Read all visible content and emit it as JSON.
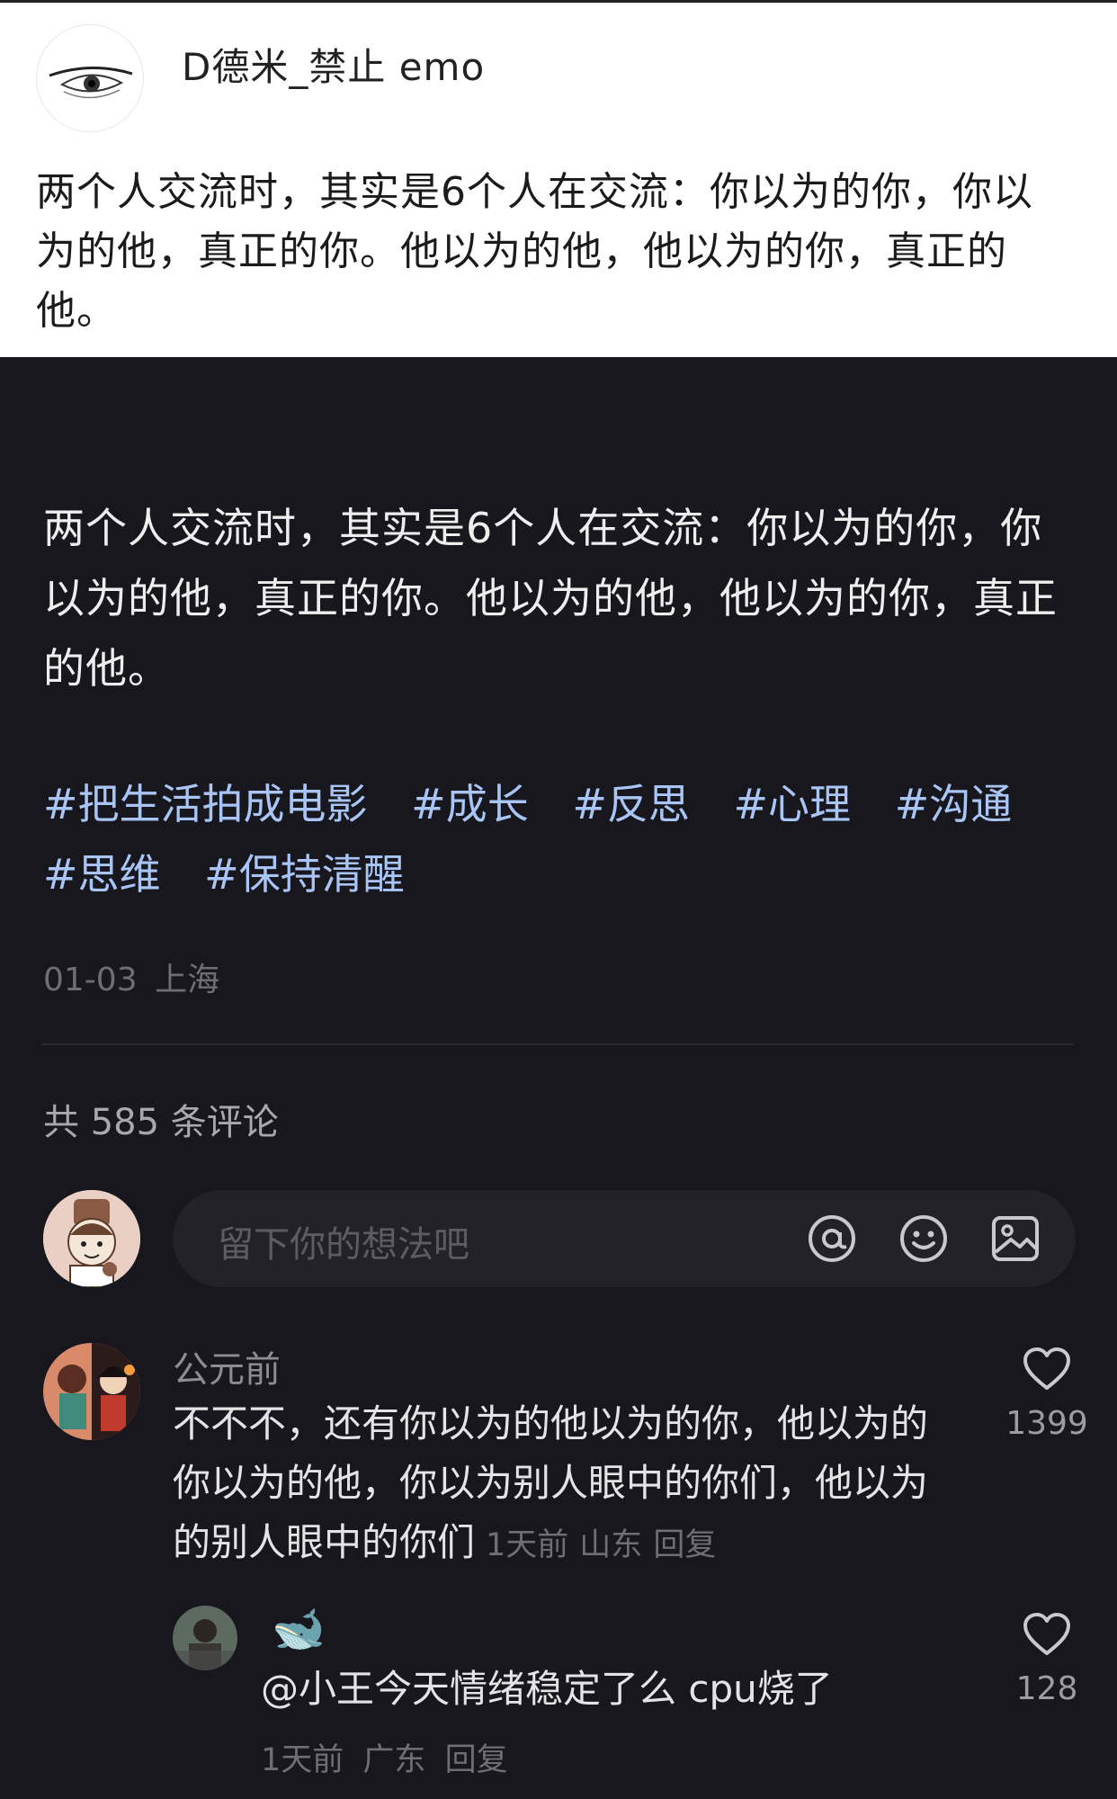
{
  "original_post": {
    "username": "D德米_禁止 emo",
    "body": "两个人交流时，其实是6个人在交流：你以为的你，你以为的他，真正的你。他以为的他，他以为的你，真正的他。"
  },
  "post": {
    "body": "两个人交流时，其实是6个人在交流：你以为的你，你以为的他，真正的你。他以为的他，他以为的你，真正的他。",
    "tags": [
      "#把生活拍成电影",
      "#成长",
      "#反思",
      "#心理",
      "#沟通",
      "#思维",
      "#保持清醒"
    ],
    "date": "01-03",
    "location": "上海"
  },
  "comments_section": {
    "count_label": "共 585 条评论",
    "input_placeholder": "留下你的想法吧",
    "icons": [
      "at-icon",
      "emoji-icon",
      "image-icon"
    ]
  },
  "comments": [
    {
      "username": "公元前",
      "text": "不不不，还有你以为的他以为的你，他以为的你以为的他，你以为别人眼中的你们，他以为的别人眼中的你们",
      "time": "1天前",
      "location": "山东",
      "reply_label": "回复",
      "likes": "1399"
    },
    {
      "username": "🐋",
      "text": "@小王今天情绪稳定了么 cpu烧了",
      "time": "1天前",
      "location": "广东",
      "reply_label": "回复",
      "likes": "128"
    }
  ],
  "colors": {
    "background": "#18171d",
    "tag": "#a8c5f5",
    "input_bg": "#232229"
  }
}
